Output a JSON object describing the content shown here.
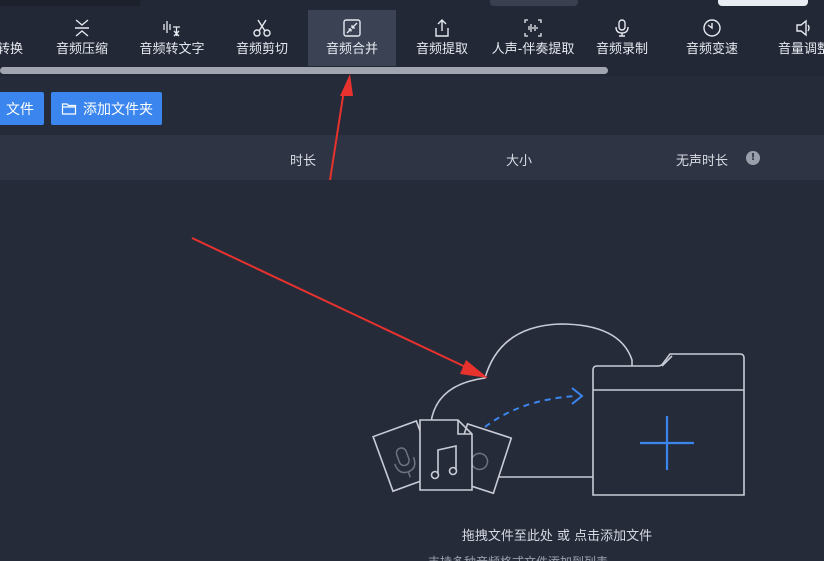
{
  "toolbar": {
    "items": [
      {
        "label": "转换",
        "icon": "convert-icon"
      },
      {
        "label": "音频压缩",
        "icon": "compress-icon"
      },
      {
        "label": "音频转文字",
        "icon": "speech-to-text-icon"
      },
      {
        "label": "音频剪切",
        "icon": "scissors-icon"
      },
      {
        "label": "音频合并",
        "icon": "merge-icon",
        "active": true
      },
      {
        "label": "音频提取",
        "icon": "upload-icon"
      },
      {
        "label": "人声-伴奏提取",
        "icon": "voice-separate-icon"
      },
      {
        "label": "音频录制",
        "icon": "microphone-icon"
      },
      {
        "label": "音频变速",
        "icon": "clock-icon"
      },
      {
        "label": "音量调整",
        "icon": "speaker-icon"
      }
    ]
  },
  "actions": {
    "add_file_label": "文件",
    "add_folder_label": "添加文件夹"
  },
  "table_header": {
    "duration": "时长",
    "size": "大小",
    "silence": "无声时长",
    "info": "!"
  },
  "dropzone": {
    "hint": "拖拽文件至此处 或 点击添加文件",
    "subhint": "支持多种音频格式文件添加到列表"
  },
  "colors": {
    "background": "#262b3a",
    "toolbar": "#232836",
    "accent": "#3a86ee",
    "annotation": "#e8322d"
  }
}
